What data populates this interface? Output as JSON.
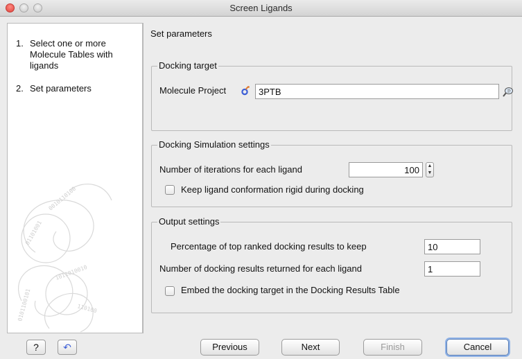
{
  "window": {
    "title": "Screen Ligands"
  },
  "steps": [
    {
      "number": "1.",
      "label": "Select one or more Molecule Tables with ligands"
    },
    {
      "number": "2.",
      "label": "Set parameters"
    }
  ],
  "panel": {
    "title": "Set parameters"
  },
  "docking_target": {
    "legend": "Docking target",
    "label": "Molecule Project",
    "value": "3PTB",
    "icons": {
      "project": "molecule-project-icon",
      "browse": "browse-icon"
    }
  },
  "simulation": {
    "legend": "Docking Simulation settings",
    "iterations_label": "Number of iterations for each ligand",
    "iterations_value": "100",
    "rigid_label": "Keep ligand conformation rigid during docking",
    "rigid_checked": false
  },
  "output": {
    "legend": "Output settings",
    "percentage_label": "Percentage of top ranked docking results to keep",
    "percentage_value": "10",
    "count_label": "Number of docking results returned for each ligand",
    "count_value": "1",
    "embed_label": "Embed the docking target in the Docking Results Table",
    "embed_checked": false
  },
  "buttons": {
    "help": "?",
    "reset": "↶",
    "previous": "Previous",
    "next": "Next",
    "finish": "Finish",
    "cancel": "Cancel"
  },
  "colors": {
    "accent": "#3d5fd6",
    "default_button_glow": "#8fb2e6"
  }
}
